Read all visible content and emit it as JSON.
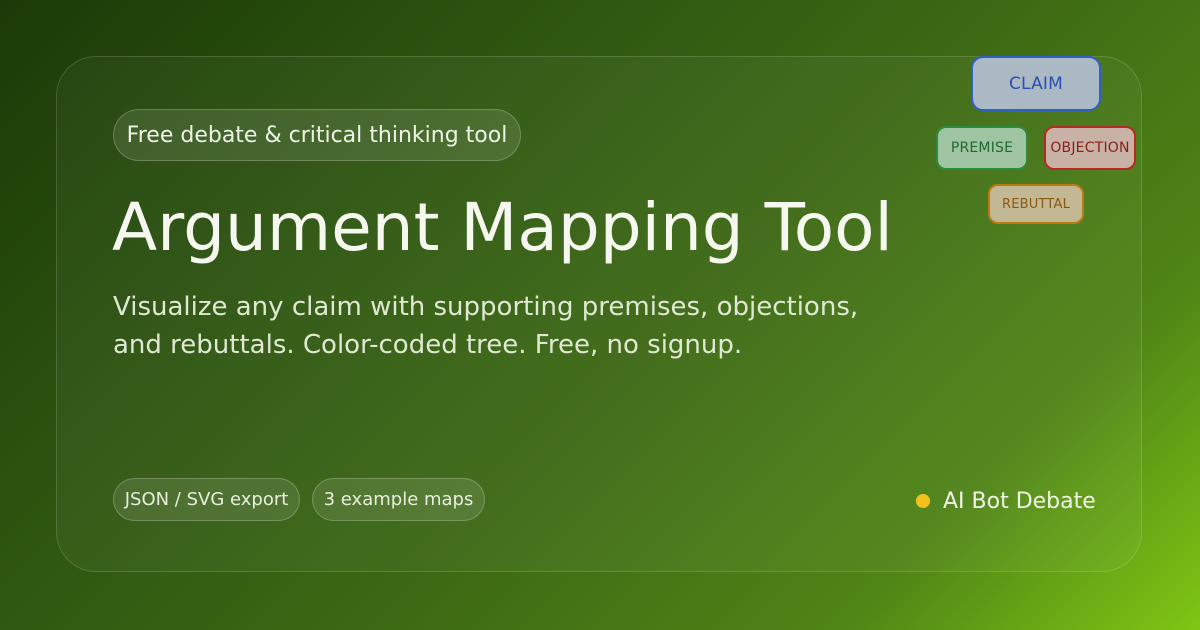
{
  "hero": {
    "badge": "Free debate & critical thinking tool",
    "title": "Argument Mapping Tool",
    "subtitle_line1": "Visualize any claim with supporting premises, objections,",
    "subtitle_line2": "and rebuttals. Color-coded tree. Free, no signup."
  },
  "tags": [
    {
      "label": "JSON / SVG export"
    },
    {
      "label": "3 example maps"
    }
  ],
  "brand": {
    "name": "AI Bot Debate",
    "dot_color": "#f3c21a"
  },
  "diagram": {
    "claim": {
      "label": "CLAIM",
      "color": "#2f5fc8"
    },
    "premise": {
      "label": "PREMISE",
      "color": "#2e8b3c"
    },
    "objection": {
      "label": "OBJECTION",
      "color": "#b52a22"
    },
    "rebuttal": {
      "label": "REBUTTAL",
      "color": "#c07a14"
    }
  },
  "colors": {
    "background_start": "#1b3a07",
    "background_end": "#7fc614"
  }
}
